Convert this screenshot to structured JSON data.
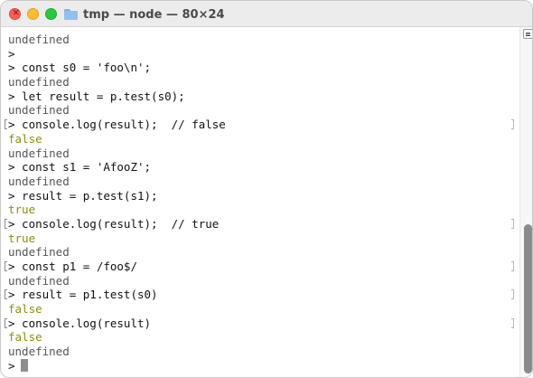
{
  "window": {
    "title": "tmp — node — 80×24",
    "folder_icon": "folder-icon"
  },
  "colors": {
    "prompt_text": "#111111",
    "output_gray": "#555555",
    "output_boolean": "#8c8f0f",
    "close": "#ff5f57",
    "minimize": "#febc2e",
    "maximize": "#28c840"
  },
  "terminal": {
    "lines": [
      {
        "text": "undefined",
        "style": "gray",
        "marked": false
      },
      {
        "text": ">",
        "style": "black",
        "marked": false
      },
      {
        "text": "> const s0 = 'foo\\n';",
        "style": "black",
        "marked": false
      },
      {
        "text": "undefined",
        "style": "gray",
        "marked": false
      },
      {
        "text": "> let result = p.test(s0);",
        "style": "black",
        "marked": false
      },
      {
        "text": "undefined",
        "style": "gray",
        "marked": false
      },
      {
        "text": "> console.log(result);  // false",
        "style": "black",
        "marked": true
      },
      {
        "text": "false",
        "style": "olive",
        "marked": false
      },
      {
        "text": "undefined",
        "style": "gray",
        "marked": false
      },
      {
        "text": "> const s1 = 'AfooZ';",
        "style": "black",
        "marked": false
      },
      {
        "text": "undefined",
        "style": "gray",
        "marked": false
      },
      {
        "text": "> result = p.test(s1);",
        "style": "black",
        "marked": false
      },
      {
        "text": "true",
        "style": "olive",
        "marked": false
      },
      {
        "text": "> console.log(result);  // true",
        "style": "black",
        "marked": true
      },
      {
        "text": "true",
        "style": "olive",
        "marked": false
      },
      {
        "text": "undefined",
        "style": "gray",
        "marked": false
      },
      {
        "text": "> const p1 = /foo$/",
        "style": "black",
        "marked": true
      },
      {
        "text": "undefined",
        "style": "gray",
        "marked": false
      },
      {
        "text": "> result = p1.test(s0)",
        "style": "black",
        "marked": true
      },
      {
        "text": "false",
        "style": "olive",
        "marked": false
      },
      {
        "text": "> console.log(result)",
        "style": "black",
        "marked": true
      },
      {
        "text": "false",
        "style": "olive",
        "marked": false
      },
      {
        "text": "undefined",
        "style": "gray",
        "marked": false
      },
      {
        "text": ">",
        "style": "black",
        "marked": false,
        "cursor": true
      }
    ]
  },
  "scrollbar": {
    "position_fraction": 0.98,
    "badge_icon": "marks-menu-icon"
  }
}
